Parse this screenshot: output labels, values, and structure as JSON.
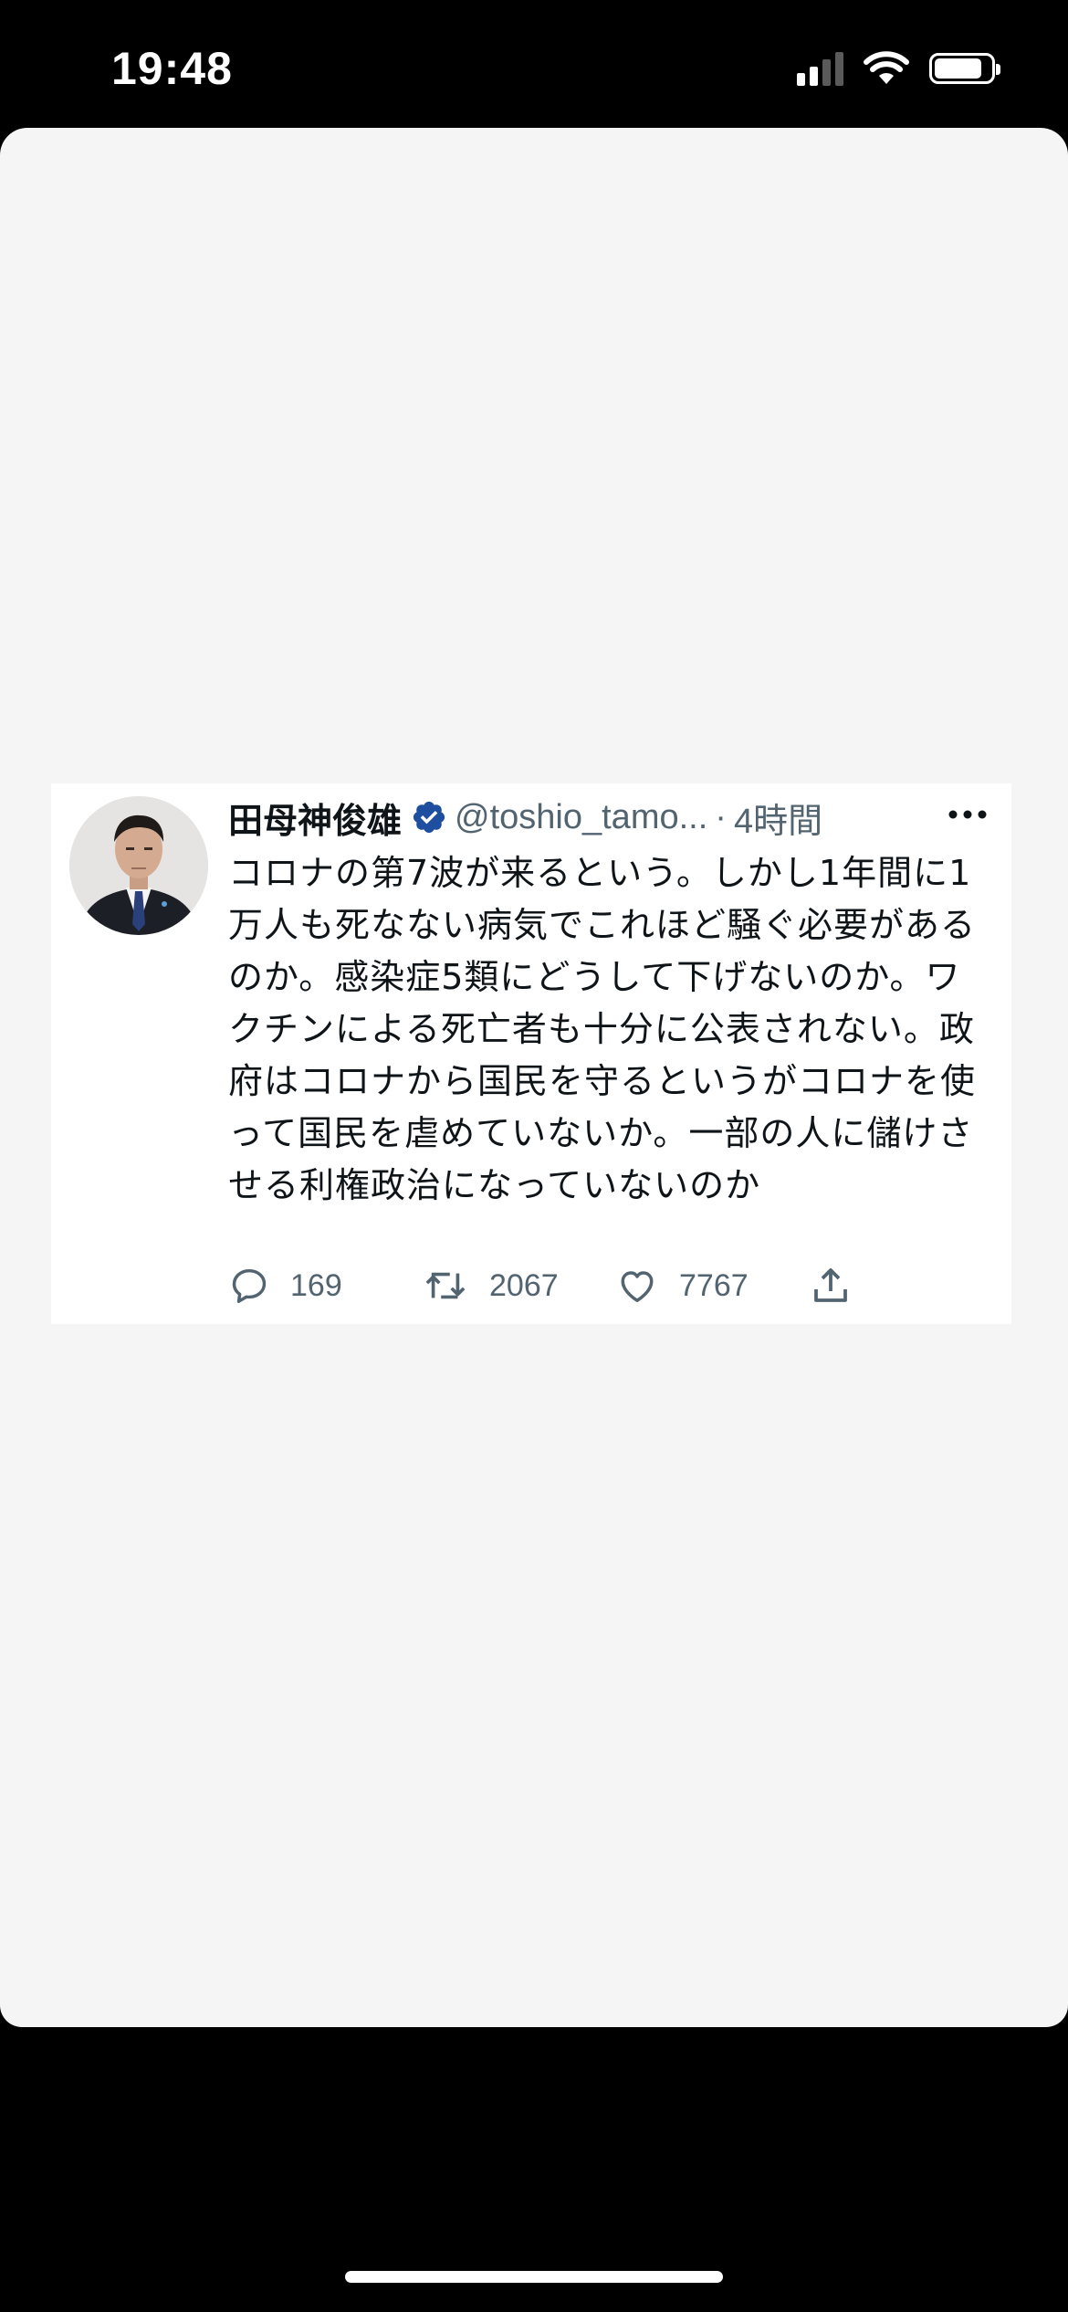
{
  "status_bar": {
    "time": "19:48",
    "signal_icon": "cellular-signal-icon",
    "wifi_icon": "wifi-icon",
    "battery_icon": "battery-icon",
    "battery_level": 0.85
  },
  "tweet": {
    "author_name": "田母神俊雄",
    "verified_icon": "verified-badge-icon",
    "handle": "@toshio_tamo...",
    "separator": "·",
    "time": "4時間",
    "more_icon": "more-options-icon",
    "text": "コロナの第7波が来るという。しかし1年間に1万人も死なない病気でこれほど騒ぐ必要があるのか。感染症5類にどうして下げないのか。ワクチンによる死亡者も十分に公表されない。政府はコロナから国民を守るというがコロナを使って国民を虐めていないか。一部の人に儲けさせる利権政治になっていないのか",
    "actions": {
      "reply_icon": "reply-icon",
      "reply_count": "169",
      "retweet_icon": "retweet-icon",
      "retweet_count": "2067",
      "like_icon": "like-heart-icon",
      "like_count": "7767",
      "share_icon": "share-icon"
    }
  },
  "colors": {
    "sheet_background": "#f5f5f6",
    "card_background": "#ffffff",
    "text_primary": "#0f1419",
    "text_secondary": "#536471",
    "verified_blue": "#1d9bf0"
  }
}
